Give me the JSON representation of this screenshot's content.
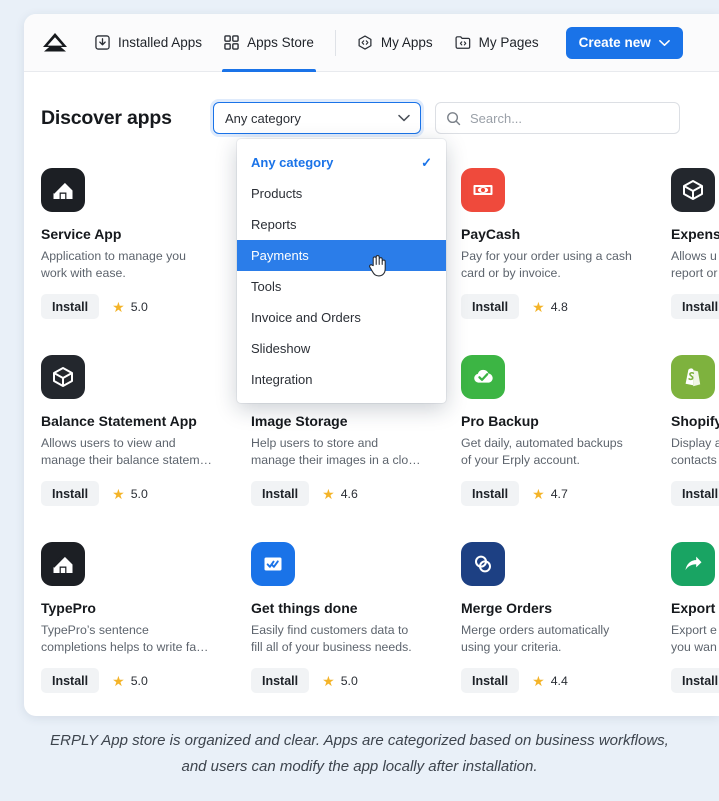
{
  "nav": {
    "logo_name": "erply-logo",
    "items": [
      {
        "label": "Installed Apps",
        "icon": "download-box-icon",
        "active": false
      },
      {
        "label": "Apps Store",
        "icon": "grid-squares-icon",
        "active": true
      },
      {
        "label": "My Apps",
        "icon": "hexagon-code-icon",
        "active": false
      },
      {
        "label": "My Pages",
        "icon": "folder-code-icon",
        "active": false
      }
    ],
    "create_new_label": "Create new"
  },
  "toolbar": {
    "title": "Discover apps",
    "category_value": "Any category",
    "search_placeholder": "Search...",
    "search_value": ""
  },
  "dropdown": {
    "open": true,
    "options": [
      {
        "label": "Any category",
        "selected": true,
        "highlighted": false
      },
      {
        "label": "Products",
        "selected": false,
        "highlighted": false
      },
      {
        "label": "Reports",
        "selected": false,
        "highlighted": false
      },
      {
        "label": "Payments",
        "selected": false,
        "highlighted": true
      },
      {
        "label": "Tools",
        "selected": false,
        "highlighted": false
      },
      {
        "label": "Invoice and Orders",
        "selected": false,
        "highlighted": false
      },
      {
        "label": "Slideshow",
        "selected": false,
        "highlighted": false
      },
      {
        "label": "Integration",
        "selected": false,
        "highlighted": false
      }
    ],
    "check_glyph": "✓"
  },
  "install_label": "Install",
  "apps": [
    {
      "name": "Service App",
      "desc": "Application to manage you work with ease.",
      "rating": "5.0",
      "icon": "house-app-icon",
      "icon_bg": "#1c1f24",
      "install_label": "Install"
    },
    {
      "name": "",
      "desc": "",
      "rating": "",
      "icon": "hidden-behind-dropdown",
      "icon_bg": "",
      "install_label": ""
    },
    {
      "name": "PayCash",
      "desc": "Pay for your order using a cash card or by invoice.",
      "rating": "4.8",
      "icon": "cash-note-icon",
      "icon_bg": "#ef4a3c",
      "install_label": "Install"
    },
    {
      "name": "Expense",
      "desc": "Allows u report or",
      "rating": "",
      "icon": "cube-box-icon",
      "icon_bg": "#23272d",
      "install_label": "Install"
    },
    {
      "name": "Balance Statement App",
      "desc": "Allows users to view and manage their balance statem…",
      "rating": "5.0",
      "icon": "cube-box-icon",
      "icon_bg": "#23272d",
      "install_label": "Install"
    },
    {
      "name": "Image Storage",
      "desc": "Help users to store and manage their images in a clo…",
      "rating": "4.6",
      "icon": "image-cloud-icon",
      "icon_bg": "#22b8e0",
      "install_label": "Install"
    },
    {
      "name": "Pro Backup",
      "desc": "Get daily, automated backups of your Erply account.",
      "rating": "4.7",
      "icon": "cloud-check-icon",
      "icon_bg": "#3cb544",
      "install_label": "Install"
    },
    {
      "name": "Shopify",
      "desc": "Display a contacts",
      "rating": "",
      "icon": "shopify-bag-icon",
      "icon_bg": "#7eb23e",
      "install_label": "Install"
    },
    {
      "name": "TypePro",
      "desc": "TypePro's sentence completions helps to write fa…",
      "rating": "5.0",
      "icon": "house-app-icon",
      "icon_bg": "#1c1f24",
      "install_label": "Install"
    },
    {
      "name": "Get things done",
      "desc": "Easily find customers data to fill all of your business needs.",
      "rating": "5.0",
      "icon": "checklist-card-icon",
      "icon_bg": "#1a73e8",
      "install_label": "Install"
    },
    {
      "name": "Merge Orders",
      "desc": "Merge orders automatically using your criteria.",
      "rating": "4.4",
      "icon": "venn-circles-icon",
      "icon_bg": "#1d4083",
      "install_label": "Install"
    },
    {
      "name": "Export",
      "desc": "Export e you wan",
      "rating": "",
      "icon": "share-arrow-icon",
      "icon_bg": "#19a463",
      "install_label": "Install"
    }
  ],
  "caption": "ERPLY App store is organized and clear. Apps are categorized based on business workflows, and users can modify the app locally after installation.",
  "colors": {
    "accent": "#1a73e8",
    "page_bg": "#e9f0f8",
    "star": "#f4b429"
  }
}
